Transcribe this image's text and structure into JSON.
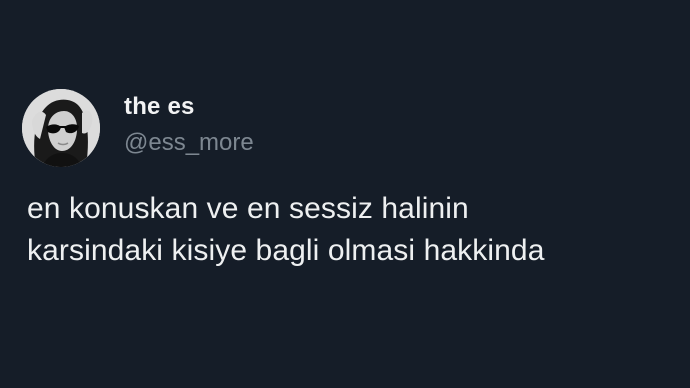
{
  "tweet": {
    "author": {
      "display_name": "the es",
      "handle": "@ess_more",
      "avatar_icon": "profile-photo"
    },
    "text_lines": [
      "en konuskan ve en sessiz halinin",
      "karsindaki kisiye bagli olmasi hakkinda"
    ]
  },
  "colors": {
    "background": "#151d28",
    "primary_text": "#eef0f1",
    "secondary_text": "#7d8791"
  }
}
